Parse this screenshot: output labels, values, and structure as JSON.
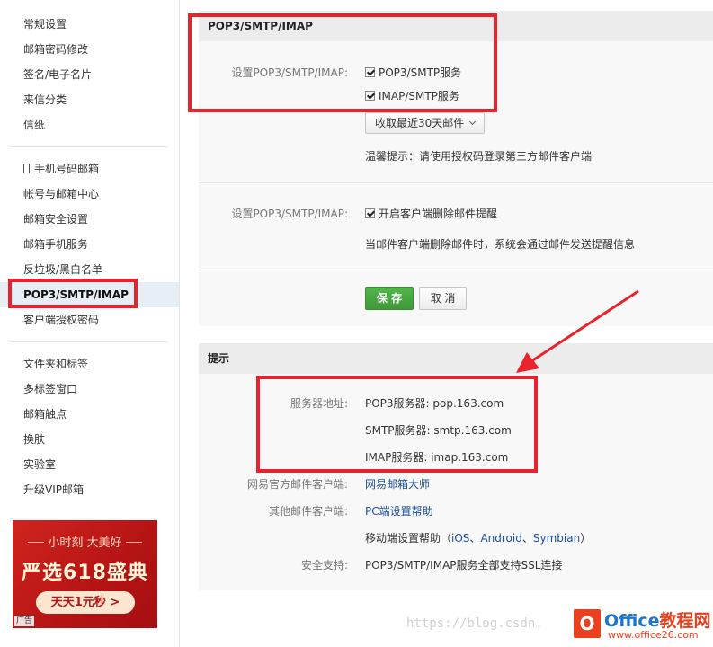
{
  "sidebar": {
    "group1": [
      "常规设置",
      "邮箱密码修改",
      "签名/电子名片",
      "来信分类",
      "信纸"
    ],
    "group2": [
      "手机号码邮箱",
      "帐号与邮箱中心",
      "邮箱安全设置",
      "邮箱手机服务",
      "反垃圾/黑白名单",
      "POP3/SMTP/IMAP",
      "客户端授权密码"
    ],
    "group3": [
      "文件夹和标签",
      "多标签窗口",
      "邮箱触点",
      "换肤",
      "实验室",
      "升级VIP邮箱"
    ]
  },
  "ad": {
    "subtitle": "小时刻 大美好",
    "title": "严选618盛典",
    "button": "天天1元秒 >",
    "tag": "广告"
  },
  "pop_panel": {
    "title": "POP3/SMTP/IMAP",
    "setting_label": "设置POP3/SMTP/IMAP:",
    "pop3_option": "POP3/SMTP服务",
    "imap_option": "IMAP/SMTP服务",
    "receive_select": "收取最近30天邮件",
    "tip": "温馨提示：请使用授权码登录第三方邮件客户端",
    "setting_label2": "设置POP3/SMTP/IMAP:",
    "delete_notify_option": "开启客户端删除邮件提醒",
    "delete_notify_desc": "当邮件客户端删除邮件时，系统会通过邮件发送提醒信息",
    "save": "保 存",
    "cancel": "取 消"
  },
  "tips_panel": {
    "title": "提示",
    "server_label": "服务器地址:",
    "pop3_server": "POP3服务器: pop.163.com",
    "smtp_server": "SMTP服务器: smtp.163.com",
    "imap_server": "IMAP服务器: imap.163.com",
    "official_client_label": "网易官方邮件客户端:",
    "official_client_link": "网易邮箱大师",
    "other_client_label": "其他邮件客户端:",
    "pc_help_link": "PC端设置帮助",
    "mobile_help_prefix": "移动端设置帮助（",
    "ios_link": "iOS",
    "sep1": "、",
    "android_link": "Android",
    "sep2": "、",
    "symbian_link": "Symbian",
    "mobile_help_suffix": "）",
    "security_label": "安全支持:",
    "security_value": "POP3/SMTP/IMAP服务全部支持SSL连接"
  },
  "watermark": {
    "text": "https://blog.csdn.",
    "logo_icon": "O",
    "logo_name_a": "Office",
    "logo_name_b": "教程网",
    "logo_url": "www.office26.com"
  },
  "colors": {
    "highlight": "#e8232b",
    "save_button": "#48a841",
    "link": "#1a4f9c"
  }
}
